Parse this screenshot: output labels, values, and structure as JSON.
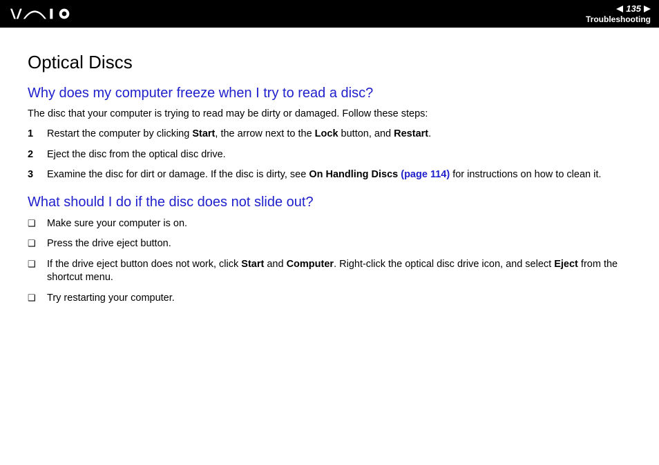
{
  "header": {
    "page_number": "135",
    "section": "Troubleshooting"
  },
  "title": "Optical Discs",
  "q1": {
    "heading": "Why does my computer freeze when I try to read a disc?",
    "lead": "The disc that your computer is trying to read may be dirty or damaged. Follow these steps:",
    "steps": {
      "s1_a": "Restart the computer by clicking ",
      "s1_b": "Start",
      "s1_c": ", the arrow next to the ",
      "s1_d": "Lock",
      "s1_e": " button, and ",
      "s1_f": "Restart",
      "s1_g": ".",
      "s2": "Eject the disc from the optical disc drive.",
      "s3_a": "Examine the disc for dirt or damage. If the disc is dirty, see ",
      "s3_b": "On Handling Discs ",
      "s3_c": "(page 114)",
      "s3_d": " for instructions on how to clean it."
    }
  },
  "q2": {
    "heading": "What should I do if the disc does not slide out?",
    "bullets": {
      "b1": "Make sure your computer is on.",
      "b2": "Press the drive eject button.",
      "b3_a": "If the drive eject button does not work, click ",
      "b3_b": "Start",
      "b3_c": " and ",
      "b3_d": "Computer",
      "b3_e": ". Right-click the optical disc drive icon, and select ",
      "b3_f": "Eject",
      "b3_g": " from the shortcut menu.",
      "b4": "Try restarting your computer."
    }
  }
}
